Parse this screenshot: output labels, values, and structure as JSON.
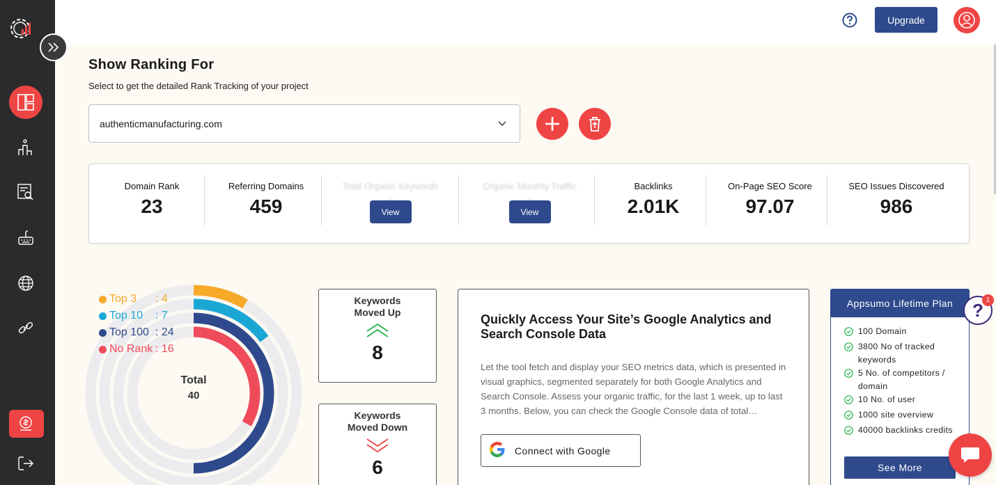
{
  "topbar": {
    "upgrade_label": "Upgrade"
  },
  "page": {
    "title": "Show Ranking For",
    "subtitle": "Select to get the detailed Rank Tracking of your project",
    "selected_project": "authenticmanufacturing.com"
  },
  "stats": [
    {
      "label": "Domain Rank",
      "value": "23"
    },
    {
      "label": "Referring Domains",
      "value": "459"
    },
    {
      "label": "Total Organic Keywords",
      "value": "0",
      "button": "View"
    },
    {
      "label": "Organic Monthly Traffic",
      "value": "0",
      "button": "View"
    },
    {
      "label": "Backlinks",
      "value": "2.01K"
    },
    {
      "label": "On-Page SEO Score",
      "value": "97.07"
    },
    {
      "label": "SEO Issues Discovered",
      "value": "986"
    }
  ],
  "chart_data": {
    "type": "pie",
    "categories": [
      "Top 3",
      "Top 10",
      "Top 100",
      "No Rank"
    ],
    "values": [
      4,
      7,
      24,
      16
    ],
    "colors": [
      "#f7a928",
      "#1ba7d4",
      "#2e4a8c",
      "#f04b5b"
    ],
    "total_label": "Total",
    "total_value": "40"
  },
  "legend": [
    {
      "name": "Top 3",
      "value": ": 4",
      "color": "#f7a928"
    },
    {
      "name": "Top 10",
      "value": ": 7",
      "color": "#1ba7d4"
    },
    {
      "name": "Top 100",
      "value": ": 24",
      "color": "#2e4a8c"
    },
    {
      "name": "No Rank",
      "value": ": 16",
      "color": "#f04b5b"
    }
  ],
  "keywords_up": {
    "title_line1": "Keywords",
    "title_line2": "Moved Up",
    "value": "8"
  },
  "keywords_down": {
    "title_line1": "Keywords",
    "title_line2": "Moved Down",
    "value": "6"
  },
  "ga_card": {
    "title": "Quickly Access Your Site’s Google Analytics and Search Console Data",
    "description": "Let the tool fetch and display your SEO metrics data, which is presented in visual graphics, segmented separately for both Google Analytics and Search Console. Assess your organic traffic, for the last 1 week, up to last 3 months. Below, you can check the Google Console data of total…",
    "button_label": "Connect with Google"
  },
  "plan": {
    "title": "Appsumo Lifetime Plan",
    "items": [
      "100 Domain",
      "3800 No of tracked keywords",
      "5 No. of competitors / domain",
      "10 No. of user",
      "1000 site overview",
      "40000 backlinks credits"
    ],
    "see_more_label": "See More"
  },
  "help_badge": "1",
  "icons": {
    "sidebar": [
      "logo-gear-chart-icon",
      "expand-sidebar-icon",
      "dashboard-icon",
      "rank-tracker-icon",
      "site-audit-icon",
      "keyword-icon",
      "backlinks-globe-icon",
      "link-icon",
      "cost-icon",
      "logout-icon"
    ],
    "accent": "#ef4444",
    "brand": "#2e4a8c"
  }
}
